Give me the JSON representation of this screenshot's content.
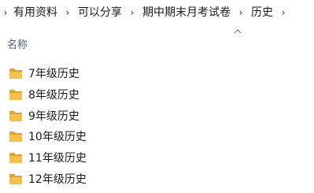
{
  "breadcrumb": {
    "items": [
      "有用资料",
      "可以分享",
      "期中期末月考试卷",
      "历史"
    ]
  },
  "columns": {
    "name_label": "名称"
  },
  "icons": {
    "folder": "folder-icon",
    "separator": "chevron-right-icon",
    "sort": "chevron-up-icon"
  },
  "colors": {
    "folder": "#f2c14e",
    "folder_dark": "#dba23a",
    "header_text": "#4c607a"
  },
  "folders": [
    {
      "name": "7年级历史"
    },
    {
      "name": "8年级历史"
    },
    {
      "name": "9年级历史"
    },
    {
      "name": "10年级历史"
    },
    {
      "name": "11年级历史"
    },
    {
      "name": "12年级历史"
    }
  ]
}
